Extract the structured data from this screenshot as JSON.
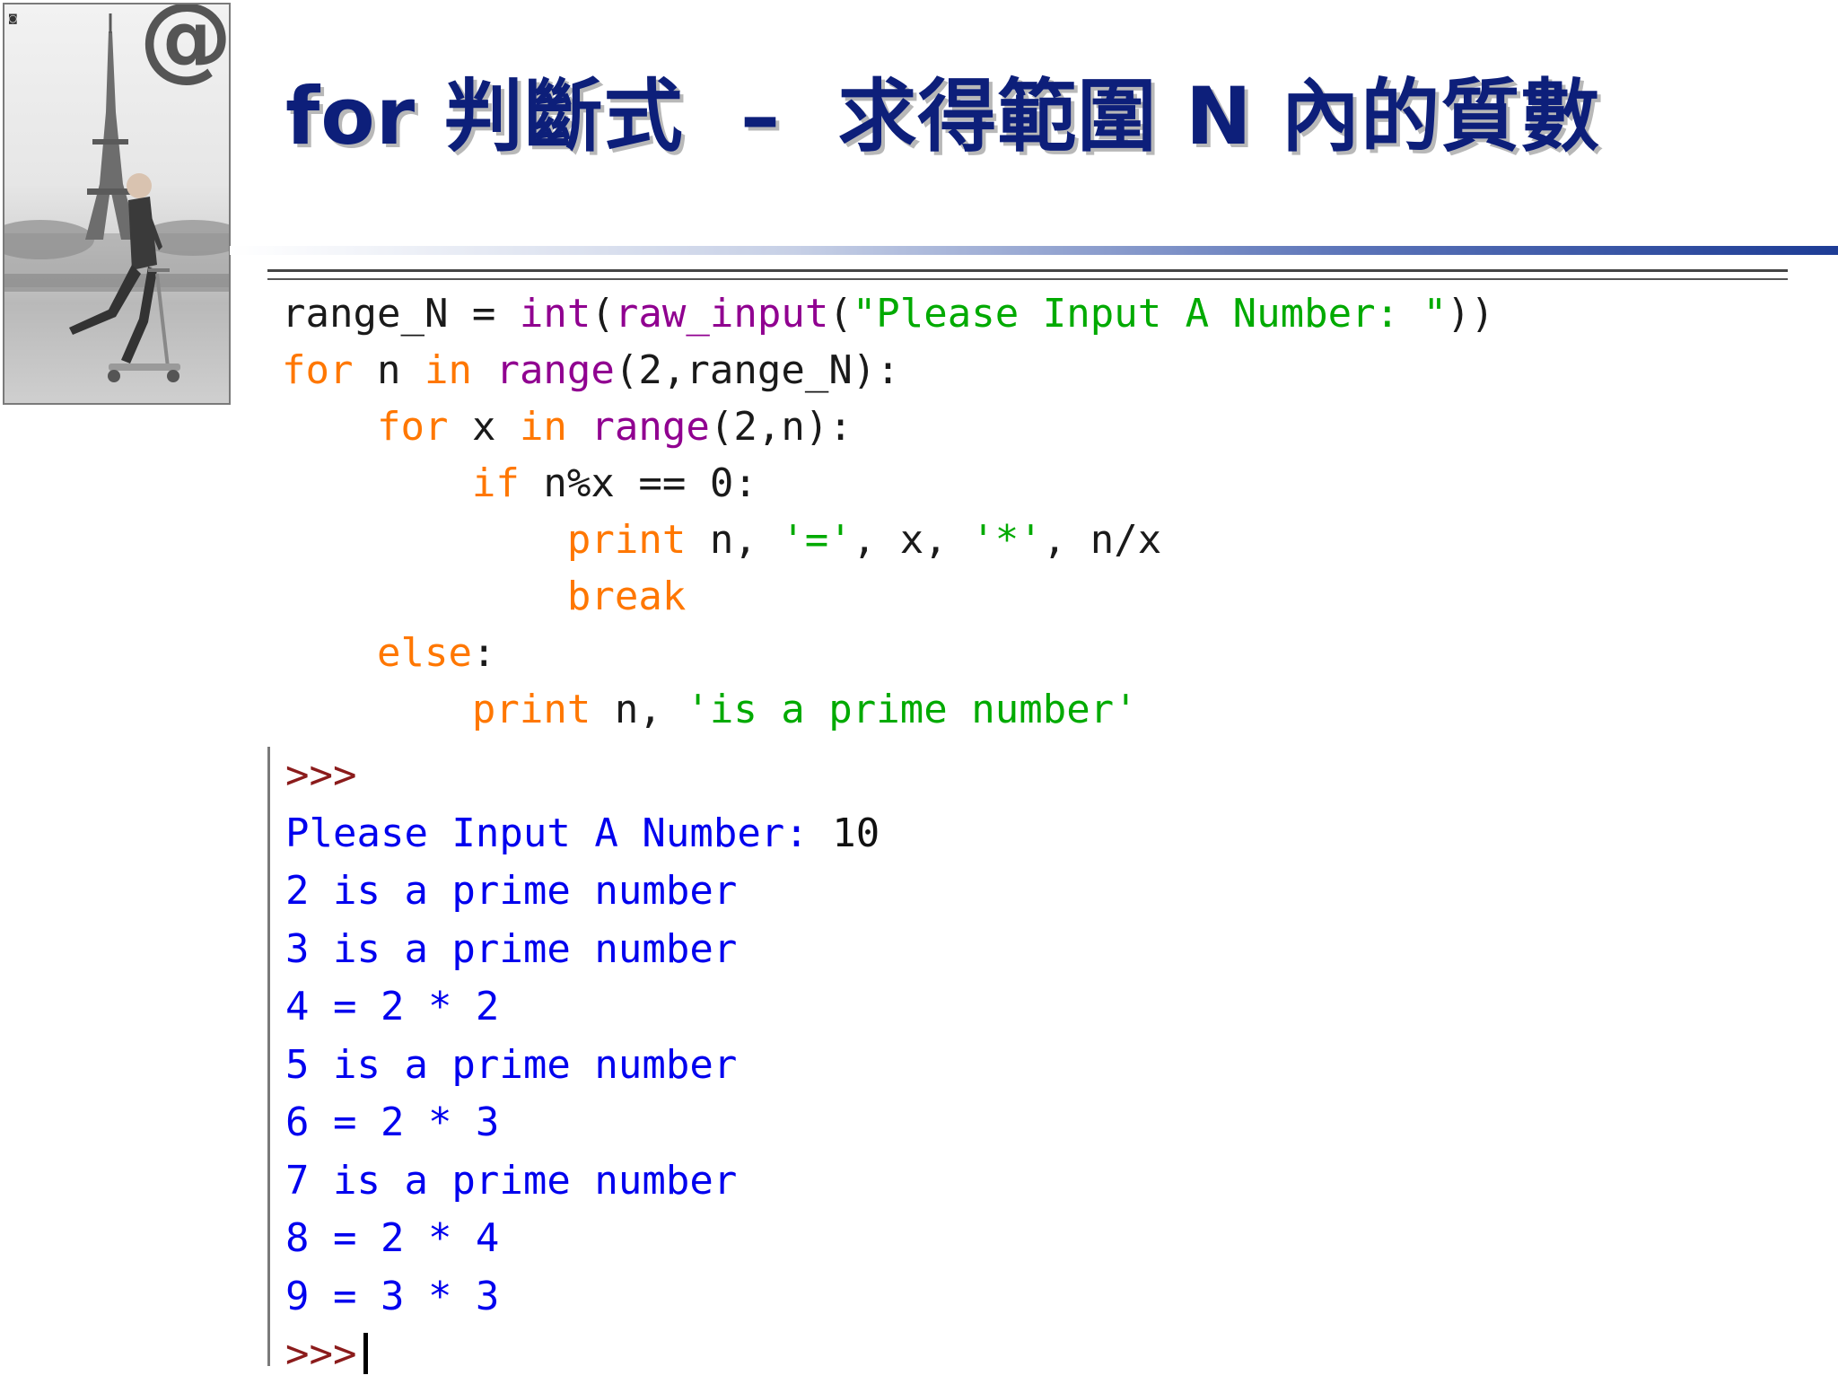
{
  "slide": {
    "title": "for 判斷式  –  求得範圍 N 內的質數",
    "logo_text": "@"
  },
  "code": {
    "lines": [
      [
        {
          "t": "range_N = ",
          "c": "plain"
        },
        {
          "t": "int",
          "c": "bi"
        },
        {
          "t": "(",
          "c": "plain"
        },
        {
          "t": "raw_input",
          "c": "bi"
        },
        {
          "t": "(",
          "c": "plain"
        },
        {
          "t": "\"Please Input A Number: \"",
          "c": "st"
        },
        {
          "t": "))",
          "c": "plain"
        }
      ],
      [
        {
          "t": "for",
          "c": "kw"
        },
        {
          "t": " n ",
          "c": "plain"
        },
        {
          "t": "in",
          "c": "kw"
        },
        {
          "t": " ",
          "c": "plain"
        },
        {
          "t": "range",
          "c": "bi"
        },
        {
          "t": "(2,range_N):",
          "c": "plain"
        }
      ],
      [
        {
          "t": "    ",
          "c": "plain"
        },
        {
          "t": "for",
          "c": "kw"
        },
        {
          "t": " x ",
          "c": "plain"
        },
        {
          "t": "in",
          "c": "kw"
        },
        {
          "t": " ",
          "c": "plain"
        },
        {
          "t": "range",
          "c": "bi"
        },
        {
          "t": "(2,n):",
          "c": "plain"
        }
      ],
      [
        {
          "t": "        ",
          "c": "plain"
        },
        {
          "t": "if",
          "c": "kw"
        },
        {
          "t": " n%x == 0:",
          "c": "plain"
        }
      ],
      [
        {
          "t": "            ",
          "c": "plain"
        },
        {
          "t": "print",
          "c": "kw"
        },
        {
          "t": " n, ",
          "c": "plain"
        },
        {
          "t": "'='",
          "c": "st"
        },
        {
          "t": ", x, ",
          "c": "plain"
        },
        {
          "t": "'*'",
          "c": "st"
        },
        {
          "t": ", n/x",
          "c": "plain"
        }
      ],
      [
        {
          "t": "            ",
          "c": "plain"
        },
        {
          "t": "break",
          "c": "kw"
        }
      ],
      [
        {
          "t": "    ",
          "c": "plain"
        },
        {
          "t": "else",
          "c": "kw"
        },
        {
          "t": ":",
          "c": "plain"
        }
      ],
      [
        {
          "t": "        ",
          "c": "plain"
        },
        {
          "t": "print",
          "c": "kw"
        },
        {
          "t": " n, ",
          "c": "plain"
        },
        {
          "t": "'is a prime number'",
          "c": "st"
        }
      ]
    ]
  },
  "shell": {
    "prompt": ">>>",
    "input_prompt": "Please Input A Number: ",
    "input_value": "10",
    "output_lines": [
      "2 is a prime number",
      "3 is a prime number",
      "4 = 2 * 2",
      "5 is a prime number",
      "6 = 2 * 3",
      "7 is a prime number",
      "8 = 2 * 4",
      "9 = 3 * 3"
    ]
  },
  "colors": {
    "title": "#0d1f7a",
    "keyword": "#ff7700",
    "builtin": "#900090",
    "string": "#00aa00",
    "shell_output": "#0000ee",
    "shell_prompt": "#8b1b1b"
  }
}
